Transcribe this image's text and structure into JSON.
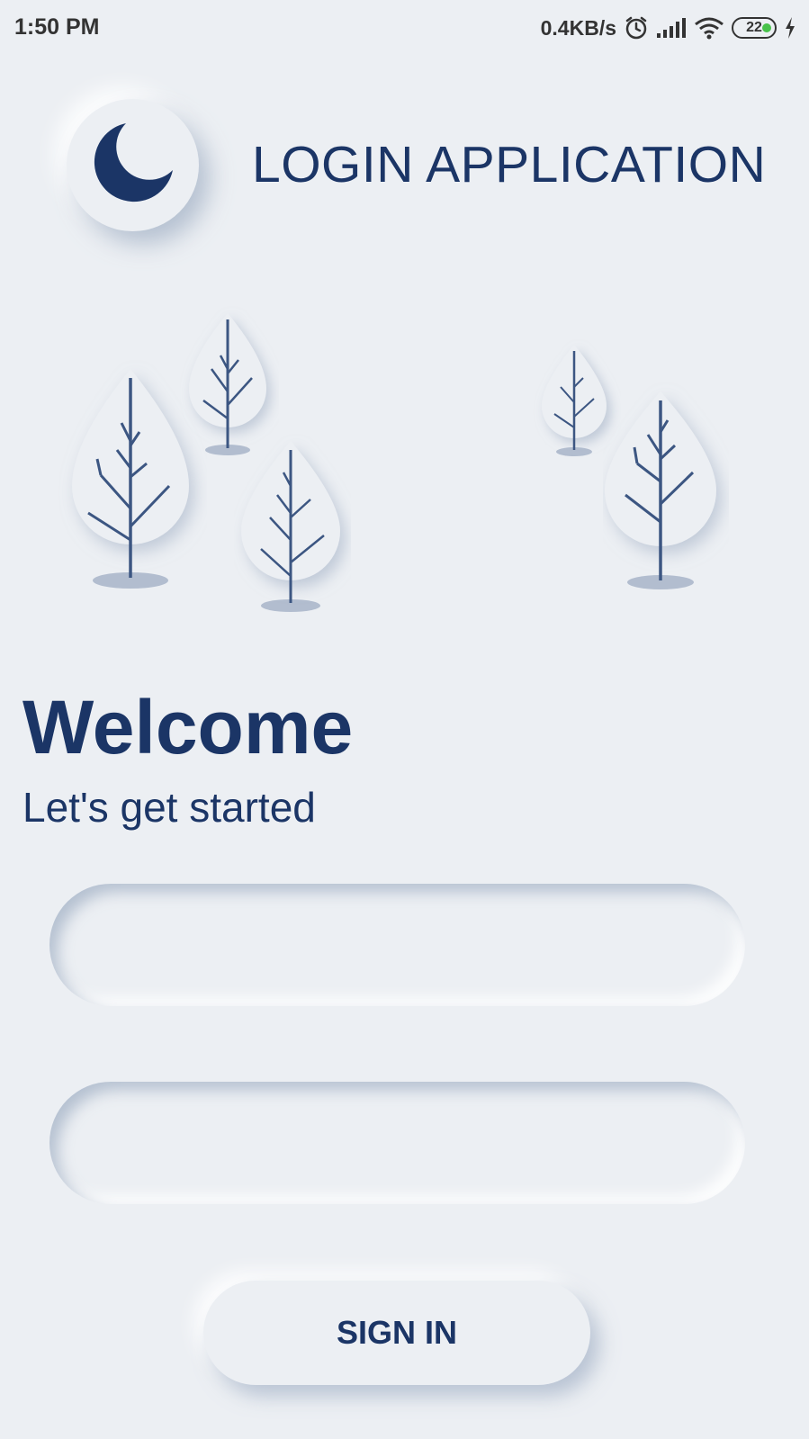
{
  "status_bar": {
    "time": "1:50 PM",
    "speed": "0.4KB/s",
    "battery": "22",
    "icons": [
      "alarm-icon",
      "signal-icon",
      "wifi-icon",
      "battery-icon",
      "charging-icon"
    ]
  },
  "header": {
    "title": "LOGIN APPLICATION",
    "logo_icon": "moon-icon"
  },
  "welcome": {
    "title": "Welcome",
    "subtitle": "Let's get started"
  },
  "form": {
    "field1_value": "",
    "field2_value": "",
    "signin_label": "SIGN IN"
  },
  "colors": {
    "background": "#eceff3",
    "primary": "#1b3566",
    "tree_trunk": "#3c5682",
    "shadow": "#b2bdcf",
    "battery_dot": "#47c24a"
  }
}
